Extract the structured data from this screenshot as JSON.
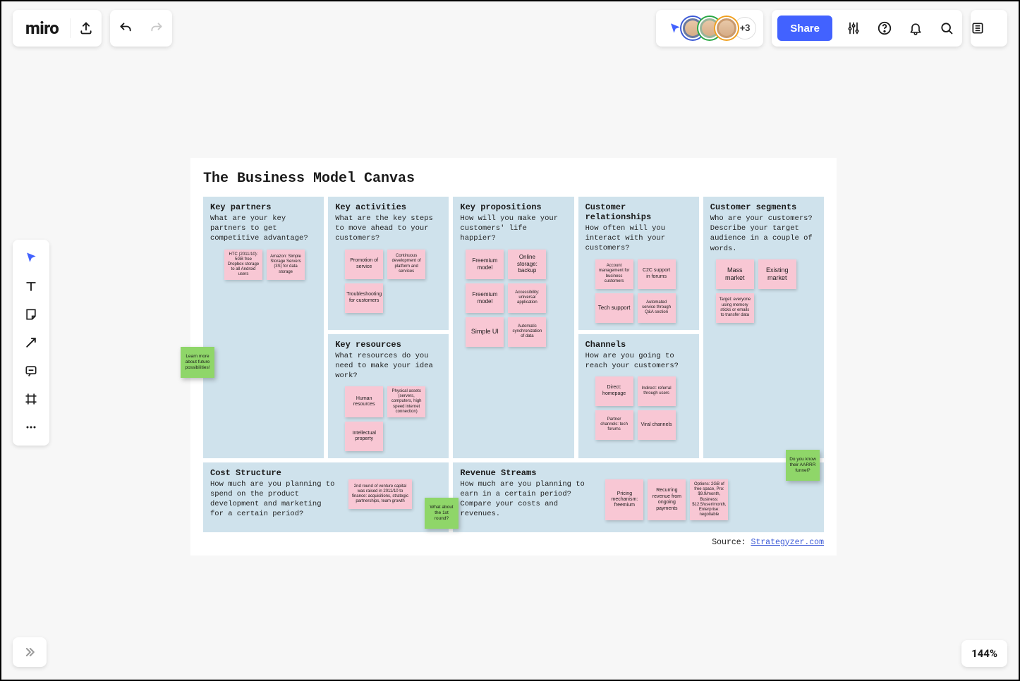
{
  "topbar": {
    "logo": "miro",
    "avatar_more": "+3",
    "share_label": "Share"
  },
  "zoom": "144%",
  "board": {
    "title": "The Business Model Canvas",
    "source_prefix": "Source: ",
    "source_link": "Strategyzer.com",
    "floats": {
      "learn_more": "Learn more about future possibilities!",
      "what_about": "What about the 1st round?",
      "aarrr": "Do you know their AARRR funnel?"
    },
    "panels": {
      "key_partners": {
        "title": "Key partners",
        "sub": "What are your key partners to get competitive advantage?",
        "stickies": [
          "HTC (2011/10): 5GB free Dropbox storage to all Android users",
          "Amazon: Simple Storage Servers (3S) for data storage"
        ]
      },
      "key_activities": {
        "title": "Key activities",
        "sub": "What are the key steps to move ahead to your customers?",
        "stickies": [
          "Promotion of service",
          "Continuous development of platform and services",
          "Troubleshooting for customers"
        ]
      },
      "key_resources": {
        "title": "Key resources",
        "sub": "What resources do you need to make your idea work?",
        "stickies": [
          "Human resources",
          "Physical assets (servers, computers, high speed internet connection)",
          "Intellectual property"
        ]
      },
      "key_prop": {
        "title": "Key propositions",
        "sub": "How will you make your customers' life happier?",
        "stickies": [
          "Freemium model",
          "Online storage: backup",
          "Freemium model",
          "Accessibility: universal application",
          "Simple UI",
          "Automatic synchronization of data"
        ]
      },
      "cust_rel": {
        "title": "Customer relationships",
        "sub": "How often will you interact with your customers?",
        "stickies": [
          "Account management for business customers",
          "C2C support in forums",
          "Tech support",
          "Automated service through Q&A section"
        ]
      },
      "channels": {
        "title": "Channels",
        "sub": "How are you going to reach your customers?",
        "stickies": [
          "Direct: homepage",
          "Indirect: referral through users",
          "Partner channels: tech forums",
          "Viral channels"
        ]
      },
      "cust_seg": {
        "title": "Customer segments",
        "sub": "Who are your customers? Describe your target audience in a couple of words.",
        "stickies": [
          "Mass market",
          "Existing market",
          "Target: everyone using memory sticks or emails to transfer data"
        ]
      },
      "cost": {
        "title": "Cost Structure",
        "sub": "How much are you planning to spend on the product development and marketing for a certain period?",
        "stickies": [
          "2nd round of venture capital was raised in 2011/10 to finance: acquisitions, strategic partnerships, team growth"
        ]
      },
      "rev": {
        "title": "Revenue Streams",
        "sub": "How much are you planning to earn in a certain period? Compare your costs and revenues.",
        "stickies": [
          "Pricing mechanism: freemium",
          "Recurring revenue from ongoing payments",
          "Options: 2GB of free space, Pro: $9.9/month, Business: $12.5/user/month, Enterprise: negotiable"
        ]
      }
    }
  }
}
